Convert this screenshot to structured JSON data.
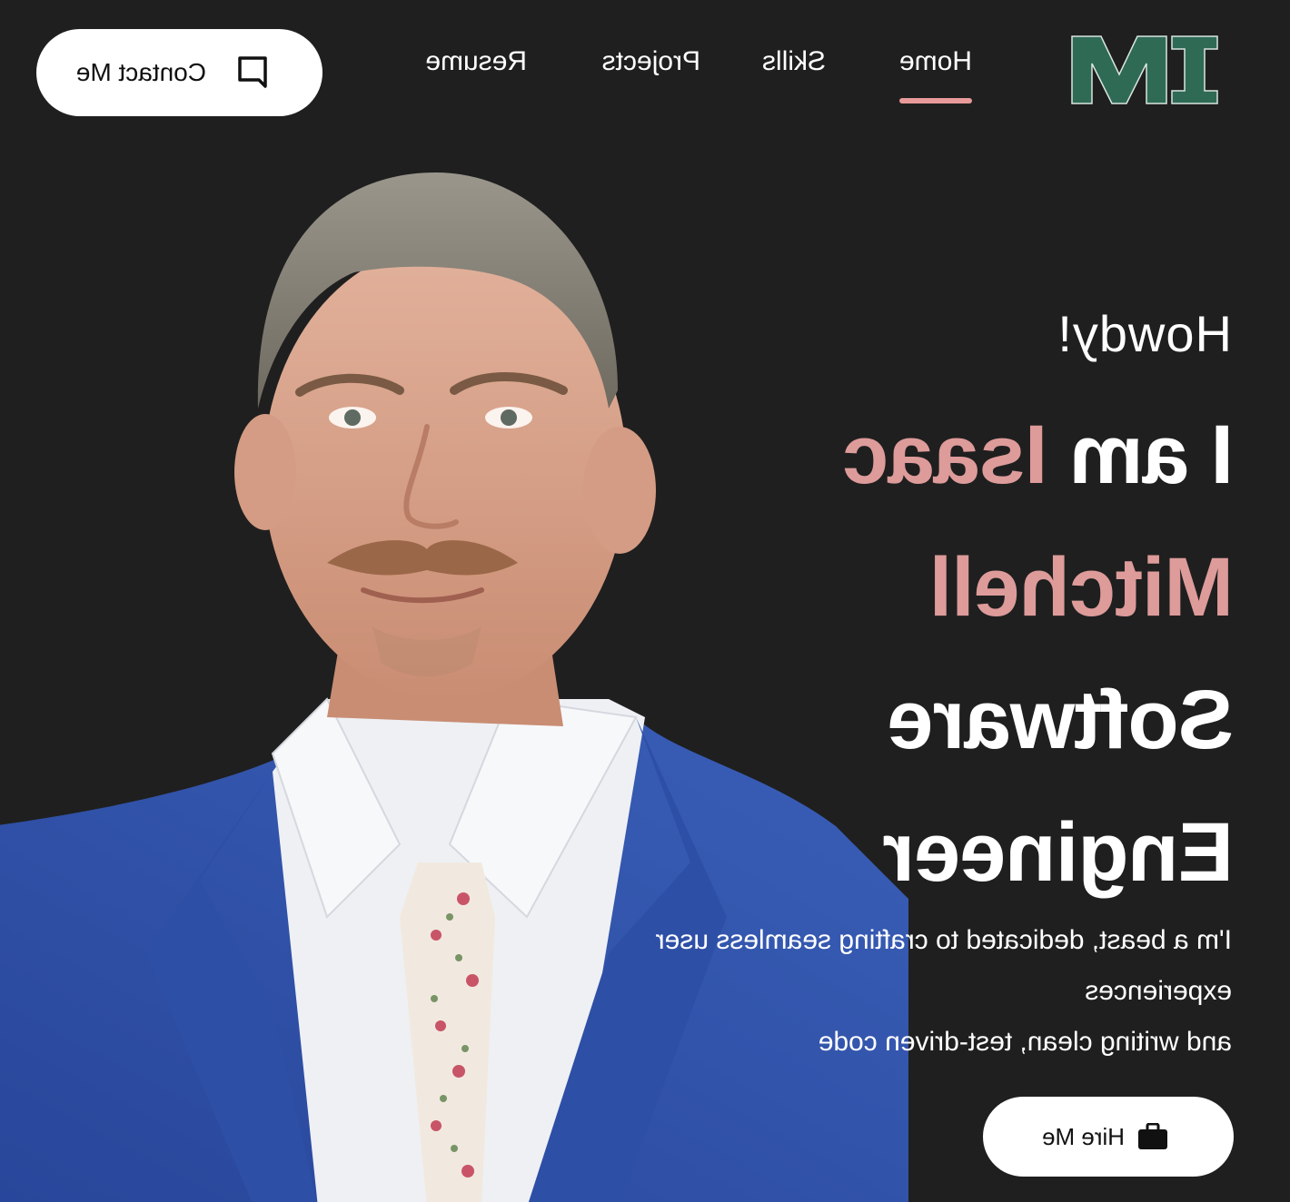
{
  "header": {
    "logo_text": "IM",
    "logo_color": "#2f6a55",
    "nav": [
      {
        "label": "Home",
        "active": true
      },
      {
        "label": "Skills",
        "active": false
      },
      {
        "label": "Projects",
        "active": false
      },
      {
        "label": "Resume",
        "active": false
      }
    ],
    "contact_label": "Contact Me",
    "contact_icon": "chat-bubble-icon",
    "active_underline_color": "#e89a9a"
  },
  "hero": {
    "greeting": "Howdy!",
    "headline": {
      "prefix": "I am ",
      "first_name": "Isaac",
      "last_name": "Mitchell",
      "title_line1": "Software",
      "title_line2": "Engineer"
    },
    "tagline_lines": [
      "I'm a beast, dedicated to crafting seamless user",
      "experiences",
      "and writing clean, test-driven code"
    ],
    "hire_label": "Hire Me",
    "hire_icon": "briefcase-icon",
    "accent_color": "#dd9b9a"
  },
  "theme": {
    "background": "#1f1f1f",
    "text": "#ffffff",
    "button_bg": "#ffffff",
    "button_text": "#111111"
  }
}
